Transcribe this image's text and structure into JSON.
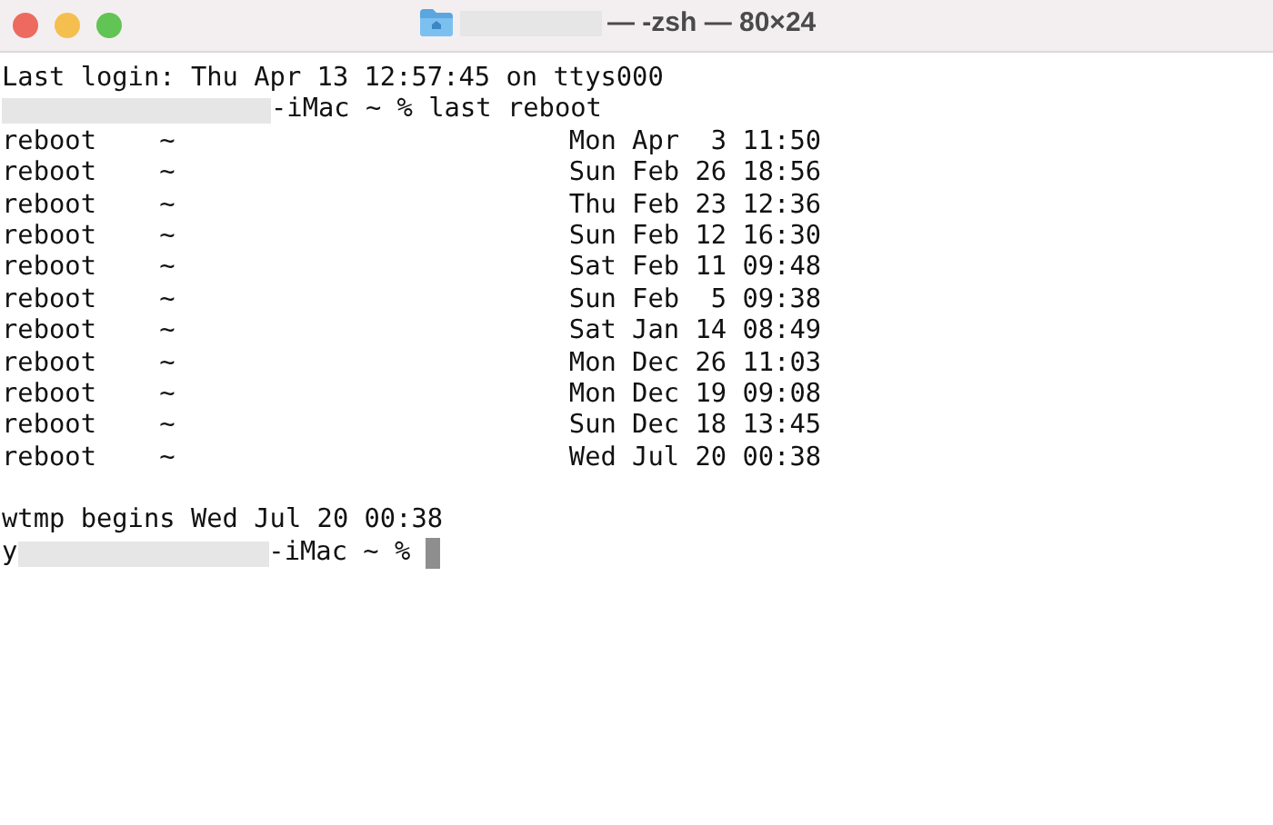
{
  "window": {
    "title": "— -zsh — 80×24"
  },
  "lines": [
    {
      "kind": "text",
      "text": "Last login: Thu Apr 13 12:57:45 on ttys000"
    },
    {
      "kind": "prompt",
      "text": "-iMac ~ % last reboot",
      "cursor": false
    },
    {
      "kind": "text",
      "text": "reboot    ~                         Mon Apr  3 11:50"
    },
    {
      "kind": "text",
      "text": "reboot    ~                         Sun Feb 26 18:56"
    },
    {
      "kind": "text",
      "text": "reboot    ~                         Thu Feb 23 12:36"
    },
    {
      "kind": "text",
      "text": "reboot    ~                         Sun Feb 12 16:30"
    },
    {
      "kind": "text",
      "text": "reboot    ~                         Sat Feb 11 09:48"
    },
    {
      "kind": "text",
      "text": "reboot    ~                         Sun Feb  5 09:38"
    },
    {
      "kind": "text",
      "text": "reboot    ~                         Sat Jan 14 08:49"
    },
    {
      "kind": "text",
      "text": "reboot    ~                         Mon Dec 26 11:03"
    },
    {
      "kind": "text",
      "text": "reboot    ~                         Mon Dec 19 09:08"
    },
    {
      "kind": "text",
      "text": "reboot    ~                         Sun Dec 18 13:45"
    },
    {
      "kind": "text",
      "text": "reboot    ~                         Wed Jul 20 00:38"
    },
    {
      "kind": "blank"
    },
    {
      "kind": "text",
      "text": "wtmp begins Wed Jul 20 00:38"
    },
    {
      "kind": "prompt",
      "lead": "y",
      "text": "-iMac ~ % ",
      "cursor": true
    }
  ]
}
